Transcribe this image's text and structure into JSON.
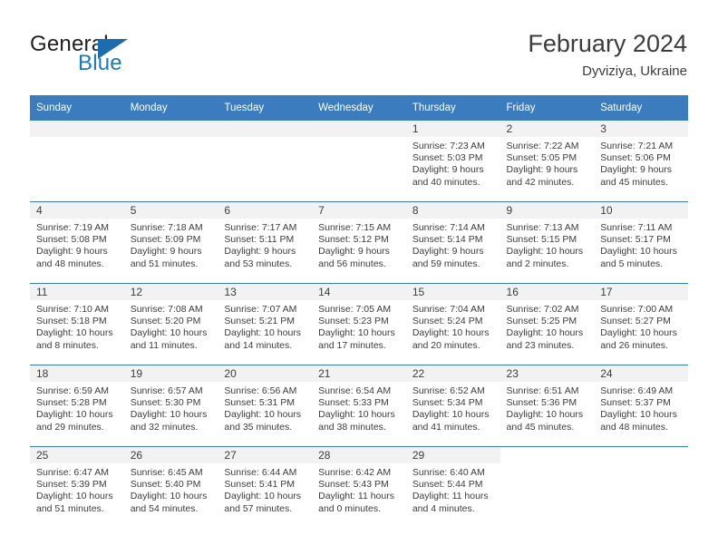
{
  "brand": {
    "word_one": "General",
    "word_two": "Blue",
    "triangle_color": "#1c6cb0",
    "blue_color": "#1c79c0"
  },
  "header": {
    "month_title": "February 2024",
    "location": "Dyviziya, Ukraine",
    "header_bg": "#3a7cbe"
  },
  "weekdays": [
    "Sunday",
    "Monday",
    "Tuesday",
    "Wednesday",
    "Thursday",
    "Friday",
    "Saturday"
  ],
  "weeks": [
    [
      {
        "day": "",
        "lines": [],
        "empty": true
      },
      {
        "day": "",
        "lines": [],
        "empty": true
      },
      {
        "day": "",
        "lines": [],
        "empty": true
      },
      {
        "day": "",
        "lines": [],
        "empty": true
      },
      {
        "day": "1",
        "lines": [
          "Sunrise: 7:23 AM",
          "Sunset: 5:03 PM",
          "Daylight: 9 hours",
          "and 40 minutes."
        ]
      },
      {
        "day": "2",
        "lines": [
          "Sunrise: 7:22 AM",
          "Sunset: 5:05 PM",
          "Daylight: 9 hours",
          "and 42 minutes."
        ]
      },
      {
        "day": "3",
        "lines": [
          "Sunrise: 7:21 AM",
          "Sunset: 5:06 PM",
          "Daylight: 9 hours",
          "and 45 minutes."
        ]
      }
    ],
    [
      {
        "day": "4",
        "lines": [
          "Sunrise: 7:19 AM",
          "Sunset: 5:08 PM",
          "Daylight: 9 hours",
          "and 48 minutes."
        ]
      },
      {
        "day": "5",
        "lines": [
          "Sunrise: 7:18 AM",
          "Sunset: 5:09 PM",
          "Daylight: 9 hours",
          "and 51 minutes."
        ]
      },
      {
        "day": "6",
        "lines": [
          "Sunrise: 7:17 AM",
          "Sunset: 5:11 PM",
          "Daylight: 9 hours",
          "and 53 minutes."
        ]
      },
      {
        "day": "7",
        "lines": [
          "Sunrise: 7:15 AM",
          "Sunset: 5:12 PM",
          "Daylight: 9 hours",
          "and 56 minutes."
        ]
      },
      {
        "day": "8",
        "lines": [
          "Sunrise: 7:14 AM",
          "Sunset: 5:14 PM",
          "Daylight: 9 hours",
          "and 59 minutes."
        ]
      },
      {
        "day": "9",
        "lines": [
          "Sunrise: 7:13 AM",
          "Sunset: 5:15 PM",
          "Daylight: 10 hours",
          "and 2 minutes."
        ]
      },
      {
        "day": "10",
        "lines": [
          "Sunrise: 7:11 AM",
          "Sunset: 5:17 PM",
          "Daylight: 10 hours",
          "and 5 minutes."
        ]
      }
    ],
    [
      {
        "day": "11",
        "lines": [
          "Sunrise: 7:10 AM",
          "Sunset: 5:18 PM",
          "Daylight: 10 hours",
          "and 8 minutes."
        ]
      },
      {
        "day": "12",
        "lines": [
          "Sunrise: 7:08 AM",
          "Sunset: 5:20 PM",
          "Daylight: 10 hours",
          "and 11 minutes."
        ]
      },
      {
        "day": "13",
        "lines": [
          "Sunrise: 7:07 AM",
          "Sunset: 5:21 PM",
          "Daylight: 10 hours",
          "and 14 minutes."
        ]
      },
      {
        "day": "14",
        "lines": [
          "Sunrise: 7:05 AM",
          "Sunset: 5:23 PM",
          "Daylight: 10 hours",
          "and 17 minutes."
        ]
      },
      {
        "day": "15",
        "lines": [
          "Sunrise: 7:04 AM",
          "Sunset: 5:24 PM",
          "Daylight: 10 hours",
          "and 20 minutes."
        ]
      },
      {
        "day": "16",
        "lines": [
          "Sunrise: 7:02 AM",
          "Sunset: 5:25 PM",
          "Daylight: 10 hours",
          "and 23 minutes."
        ]
      },
      {
        "day": "17",
        "lines": [
          "Sunrise: 7:00 AM",
          "Sunset: 5:27 PM",
          "Daylight: 10 hours",
          "and 26 minutes."
        ]
      }
    ],
    [
      {
        "day": "18",
        "lines": [
          "Sunrise: 6:59 AM",
          "Sunset: 5:28 PM",
          "Daylight: 10 hours",
          "and 29 minutes."
        ]
      },
      {
        "day": "19",
        "lines": [
          "Sunrise: 6:57 AM",
          "Sunset: 5:30 PM",
          "Daylight: 10 hours",
          "and 32 minutes."
        ]
      },
      {
        "day": "20",
        "lines": [
          "Sunrise: 6:56 AM",
          "Sunset: 5:31 PM",
          "Daylight: 10 hours",
          "and 35 minutes."
        ]
      },
      {
        "day": "21",
        "lines": [
          "Sunrise: 6:54 AM",
          "Sunset: 5:33 PM",
          "Daylight: 10 hours",
          "and 38 minutes."
        ]
      },
      {
        "day": "22",
        "lines": [
          "Sunrise: 6:52 AM",
          "Sunset: 5:34 PM",
          "Daylight: 10 hours",
          "and 41 minutes."
        ]
      },
      {
        "day": "23",
        "lines": [
          "Sunrise: 6:51 AM",
          "Sunset: 5:36 PM",
          "Daylight: 10 hours",
          "and 45 minutes."
        ]
      },
      {
        "day": "24",
        "lines": [
          "Sunrise: 6:49 AM",
          "Sunset: 5:37 PM",
          "Daylight: 10 hours",
          "and 48 minutes."
        ]
      }
    ],
    [
      {
        "day": "25",
        "lines": [
          "Sunrise: 6:47 AM",
          "Sunset: 5:39 PM",
          "Daylight: 10 hours",
          "and 51 minutes."
        ]
      },
      {
        "day": "26",
        "lines": [
          "Sunrise: 6:45 AM",
          "Sunset: 5:40 PM",
          "Daylight: 10 hours",
          "and 54 minutes."
        ]
      },
      {
        "day": "27",
        "lines": [
          "Sunrise: 6:44 AM",
          "Sunset: 5:41 PM",
          "Daylight: 10 hours",
          "and 57 minutes."
        ]
      },
      {
        "day": "28",
        "lines": [
          "Sunrise: 6:42 AM",
          "Sunset: 5:43 PM",
          "Daylight: 11 hours",
          "and 0 minutes."
        ]
      },
      {
        "day": "29",
        "lines": [
          "Sunrise: 6:40 AM",
          "Sunset: 5:44 PM",
          "Daylight: 11 hours",
          "and 4 minutes."
        ]
      },
      {
        "day": "",
        "lines": [],
        "blank": true
      },
      {
        "day": "",
        "lines": [],
        "blank": true
      }
    ]
  ]
}
